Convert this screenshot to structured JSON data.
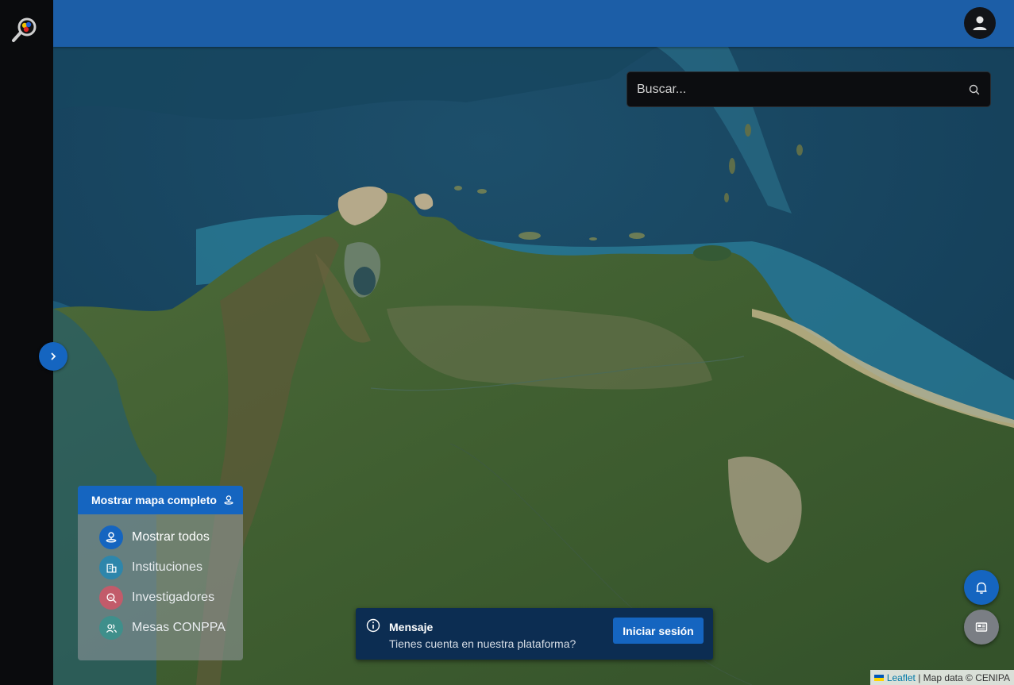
{
  "search": {
    "placeholder": "Buscar..."
  },
  "legend": {
    "header_label": "Mostrar mapa completo",
    "items": [
      {
        "label": "Mostrar todos",
        "color": "#1565c0",
        "icon": "pin-icon",
        "active": true
      },
      {
        "label": "Instituciones",
        "color": "#2e86ab",
        "icon": "building-icon",
        "active": false
      },
      {
        "label": "Investigadores",
        "color": "#c25b6a",
        "icon": "search-person-icon",
        "active": false
      },
      {
        "label": "Mesas CONPPA",
        "color": "#3f8f8b",
        "icon": "group-icon",
        "active": false
      }
    ]
  },
  "message": {
    "title": "Mensaje",
    "body": "Tienes cuenta en nuestra plataforma?",
    "button_label": "Iniciar sesión"
  },
  "attribution": {
    "leaflet": "Leaflet",
    "separator": " | ",
    "map_data": "Map data © CENIPA"
  },
  "colors": {
    "primary": "#1565c0",
    "header": "#1c5ea7",
    "sidebar": "#0a0b0d",
    "message_bg": "#0c2d52"
  }
}
